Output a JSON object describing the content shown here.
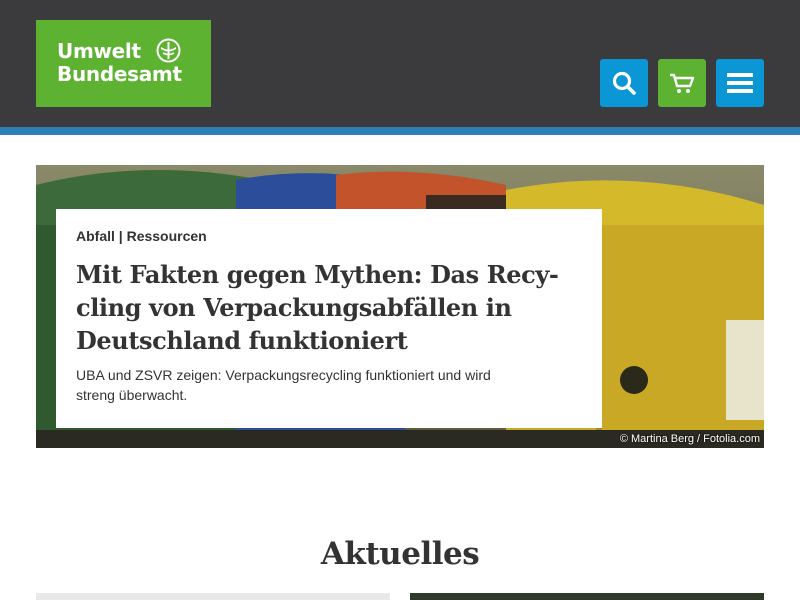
{
  "header": {
    "logo": {
      "line1": "Umwelt",
      "line2": "Bundesamt"
    },
    "buttons": {
      "search_icon": "search-icon",
      "cart_icon": "cart-icon",
      "menu_icon": "menu-icon"
    },
    "colors": {
      "background": "#3b3b3d",
      "stripe": "#2d7fb8",
      "green": "#5eb232",
      "blue": "#0b97d6"
    }
  },
  "hero": {
    "tags": "Abfall | Ressourcen",
    "title_lines": [
      "Mit Fakten gegen Mythen: Das Recy-",
      "cling von Verpackungsabfällen in",
      "Deutschland funktioniert"
    ],
    "teaser": "UBA und ZSVR zeigen: Verpackungsrecycling funktioniert und wird streng überwacht.",
    "credit": "© Martina Berg / Fotolia.com"
  },
  "section": {
    "title": "Aktuelles"
  }
}
